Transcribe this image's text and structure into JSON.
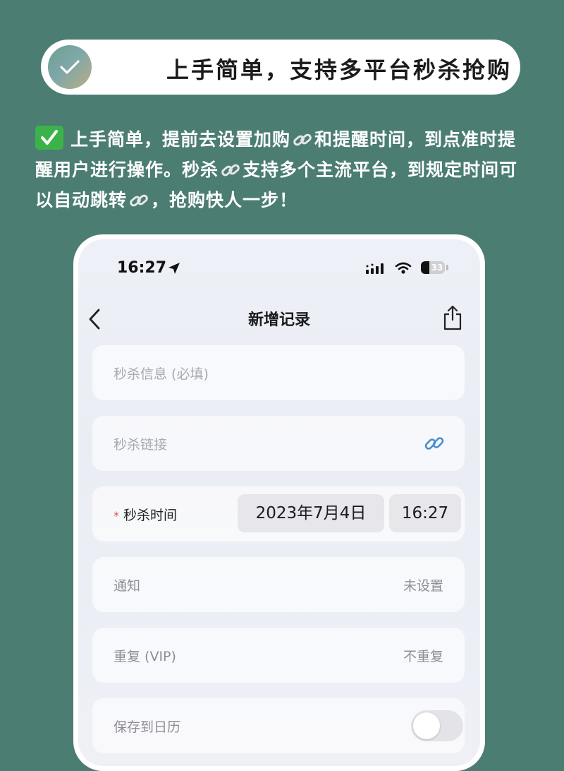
{
  "banner": {
    "title": "上手简单，支持多平台秒杀抢购"
  },
  "intro": {
    "part1": "上手简单，提前去设置加购",
    "part2": "和提醒时间，到点准时提醒用户进行操作。秒杀",
    "part3": "支持多个主流平台，到规定时间可以自动跳转",
    "part4": "，抢购快人一步！"
  },
  "status_bar": {
    "time": "16:27",
    "battery": "33"
  },
  "header": {
    "title": "新增记录"
  },
  "form": {
    "info_placeholder": "秒杀信息 (必填)",
    "link_placeholder": "秒杀链接",
    "time_required_mark": "*",
    "time_label": "秒杀时间",
    "date_value": "2023年7月4日",
    "time_value": "16:27",
    "notify_label": "通知",
    "notify_value": "未设置",
    "repeat_label": "重复 (VIP)",
    "repeat_value": "不重复",
    "calendar_label": "保存到日历",
    "calendar_enabled": false
  },
  "colors": {
    "background": "#4b7d73",
    "check_badge": "#3cb34a",
    "required": "#d94b4b",
    "link_icon": "#4a8fd0"
  },
  "icons": [
    "check-icon",
    "link-icon",
    "location-arrow-icon",
    "signal-icon",
    "wifi-icon",
    "battery-icon",
    "back-chevron-icon",
    "share-icon"
  ]
}
